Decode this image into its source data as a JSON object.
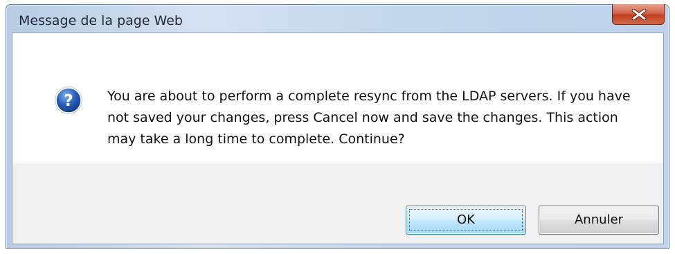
{
  "dialog": {
    "title": "Message de la page Web",
    "message": "You are about to perform a complete resync from the LDAP servers. If you have not saved your changes, press Cancel now and save the changes. This action may take a long time to complete. Continue?",
    "icon": "question-icon",
    "close_icon": "close-icon",
    "buttons": {
      "ok_label": "OK",
      "cancel_label": "Annuler"
    },
    "colors": {
      "close_button": "#c94a2e",
      "ok_button_border": "#3c7fb1",
      "footer_background": "#f0f0f0",
      "icon_blue": "#2a5fb8"
    }
  }
}
